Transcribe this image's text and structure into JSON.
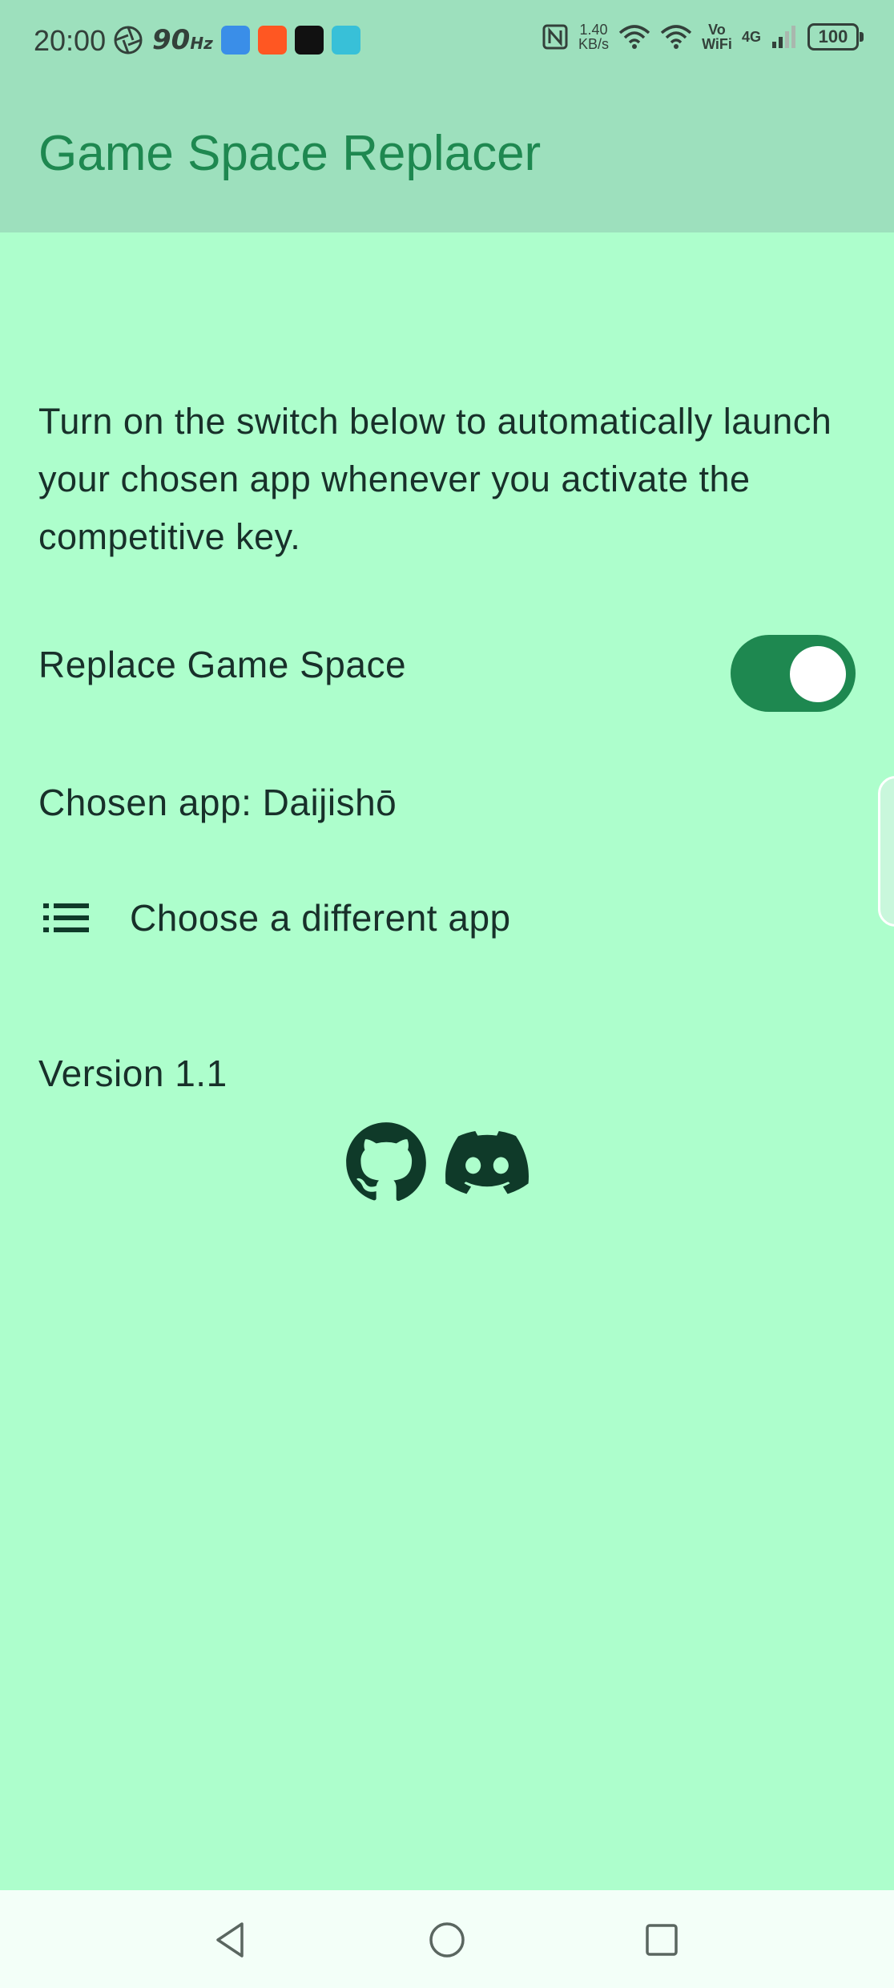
{
  "status_bar": {
    "time": "20:00",
    "refresh_rate": "90",
    "refresh_unit": "Hz",
    "net_speed_value": "1.40",
    "net_speed_unit": "KB/s",
    "volte_label": "Vo WiFi",
    "network_type": "4G",
    "battery": "100"
  },
  "app_bar": {
    "title": "Game Space Replacer"
  },
  "main": {
    "description": "Turn on the switch below to automatically launch your chosen app whenever you activate the competitive key.",
    "toggle": {
      "label": "Replace Game Space",
      "on": true
    },
    "chosen_app": "Chosen app: Daijishō",
    "choose_button": {
      "label": "Choose a different app",
      "icon": "list-icon"
    },
    "version": "Version 1.1",
    "links": [
      {
        "icon": "github-icon"
      },
      {
        "icon": "discord-icon"
      }
    ]
  },
  "nav_bar": {
    "buttons": [
      "back",
      "home",
      "recents"
    ]
  },
  "colors": {
    "background": "#adfecc",
    "app_bar": "#9de0bd",
    "accent": "#1e8850",
    "text": "#18302a",
    "icon": "#0f3a29"
  }
}
